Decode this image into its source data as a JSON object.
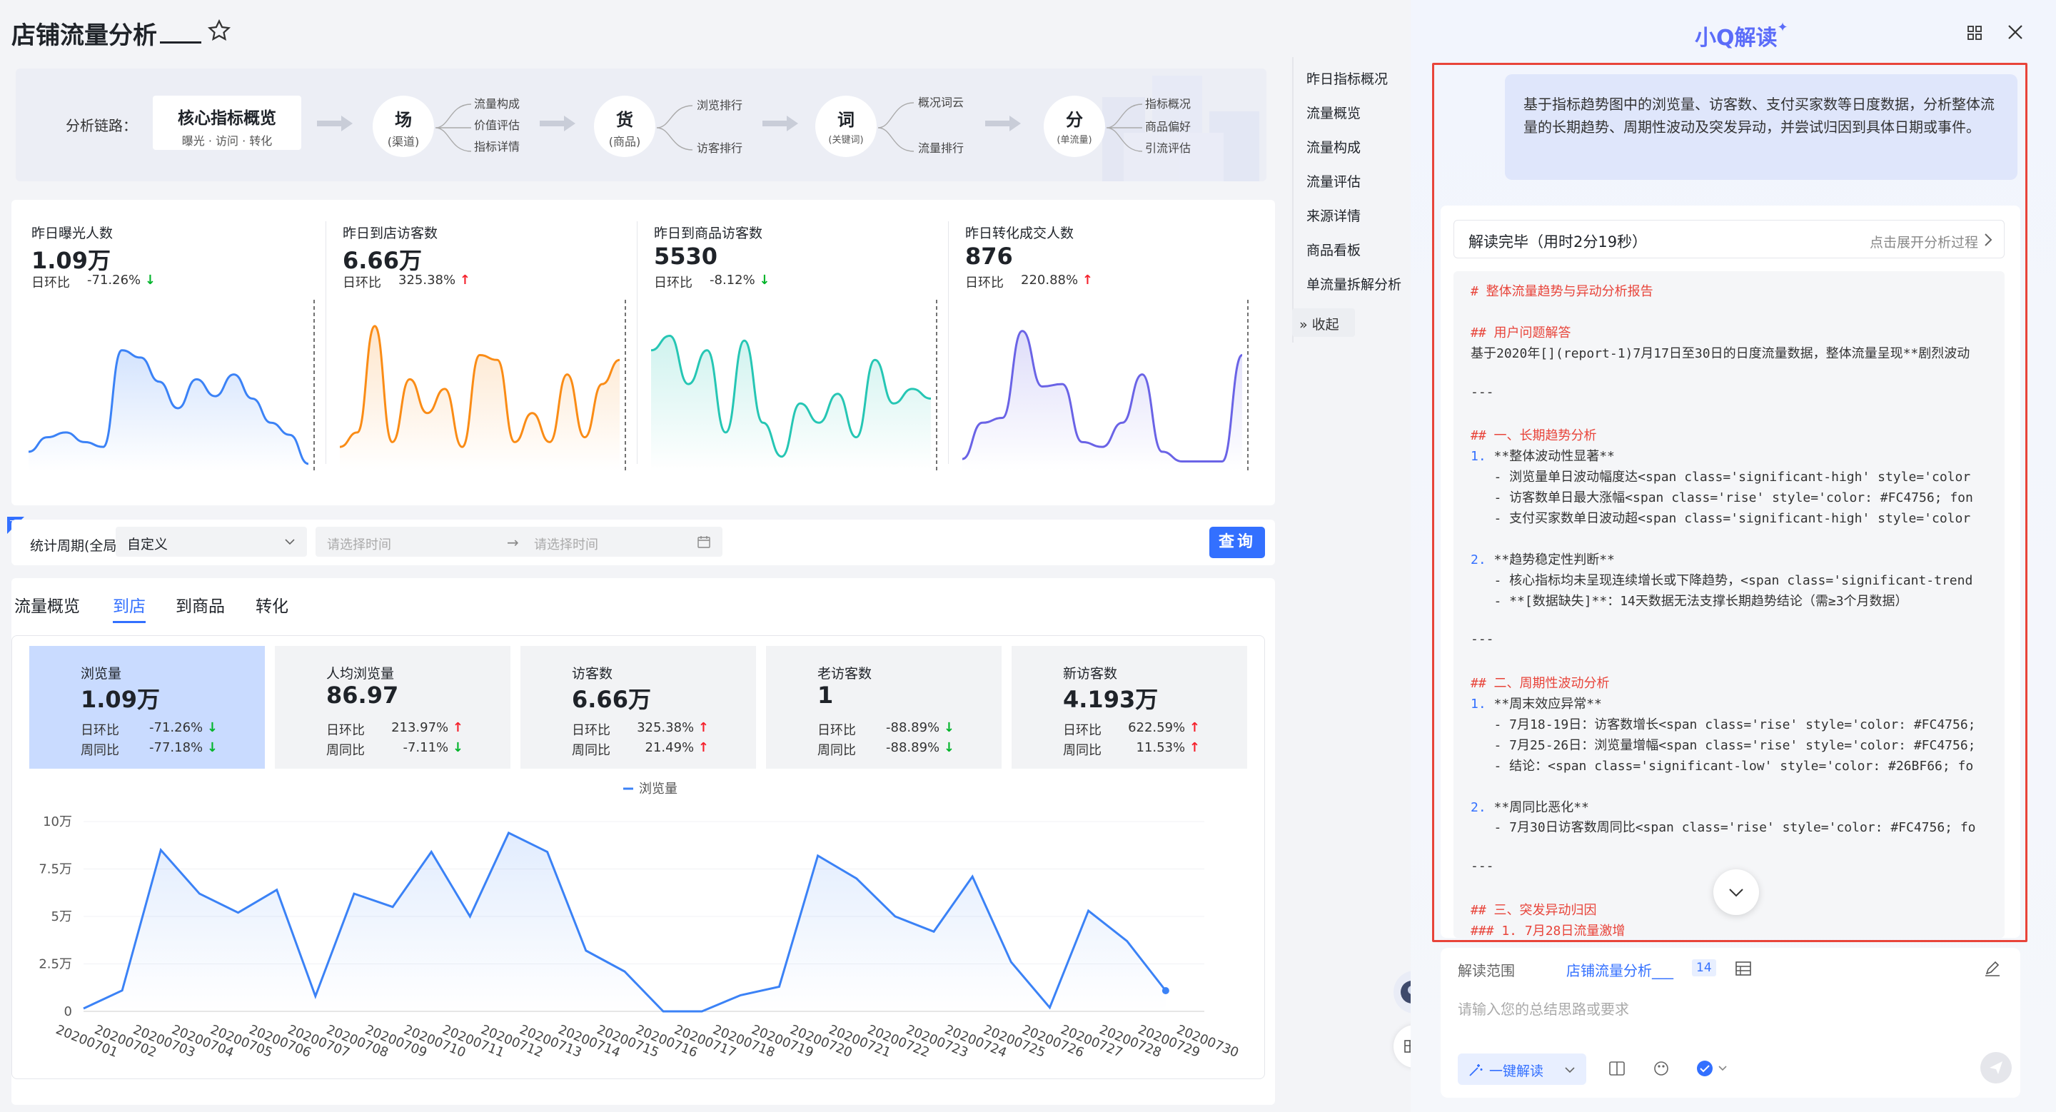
{
  "header": {
    "title": "店铺流量分析"
  },
  "chain": {
    "label": "分析链路：",
    "core_title": "核心指标概览",
    "core_sub": "曝光 · 访问 · 转化",
    "nodes": [
      {
        "t": "场",
        "s": "(渠道)",
        "subs": [
          "流量构成",
          "价值评估",
          "指标详情"
        ]
      },
      {
        "t": "货",
        "s": "(商品)",
        "subs": [
          "浏览排行",
          "访客排行"
        ]
      },
      {
        "t": "词",
        "s": "(关键词)",
        "subs": [
          "概况词云",
          "流量排行"
        ]
      },
      {
        "t": "分",
        "s": "(单流量)",
        "subs": [
          "指标概况",
          "商品偏好",
          "引流评估"
        ]
      }
    ]
  },
  "kpis": [
    {
      "label": "昨日曝光人数",
      "value": "1.09万",
      "ratio_label": "日环比",
      "ratio": "-71.26%",
      "dir": "down",
      "color": "#3b82f6",
      "series": [
        8,
        14,
        16,
        12,
        10,
        50,
        47,
        37,
        26,
        38,
        31,
        40,
        30,
        20,
        15,
        3
      ]
    },
    {
      "label": "昨日到店访客数",
      "value": "6.66万",
      "ratio_label": "日环比",
      "ratio": "325.38%",
      "dir": "up",
      "color": "#fa8c16",
      "series": [
        10,
        16,
        60,
        12,
        38,
        24,
        34,
        10,
        48,
        46,
        12,
        24,
        12,
        40,
        14,
        36,
        46
      ]
    },
    {
      "label": "昨日到商品访客数",
      "value": "5530",
      "ratio_label": "日环比",
      "ratio": "-8.12%",
      "dir": "down",
      "color": "#26c6b4",
      "series": [
        50,
        56,
        36,
        50,
        16,
        54,
        20,
        6,
        28,
        20,
        32,
        14,
        46,
        28,
        34,
        30
      ]
    },
    {
      "label": "昨日转化成交人数",
      "value": "876",
      "ratio_label": "日环比",
      "ratio": "220.88%",
      "dir": "up",
      "color": "#6a63e6",
      "series": [
        5,
        20,
        22,
        58,
        35,
        36,
        12,
        10,
        20,
        40,
        8,
        4,
        4,
        4,
        48
      ]
    }
  ],
  "filter": {
    "label": "统计周期(全局)",
    "select": "自定义",
    "start_placeholder": "请选择时间",
    "end_placeholder": "请选择时间",
    "query": "查询"
  },
  "tabs": [
    "流量概览",
    "到店",
    "到商品",
    "转化"
  ],
  "metrics": [
    {
      "label": "浏览量",
      "value": "1.09万",
      "d_label": "日环比",
      "d": "-71.26%",
      "d_dir": "down",
      "w_label": "周同比",
      "w": "-77.18%",
      "w_dir": "down",
      "selected": true
    },
    {
      "label": "人均浏览量",
      "value": "86.97",
      "d_label": "日环比",
      "d": "213.97%",
      "d_dir": "up",
      "w_label": "周同比",
      "w": "-7.11%",
      "w_dir": "down"
    },
    {
      "label": "访客数",
      "value": "6.66万",
      "d_label": "日环比",
      "d": "325.38%",
      "d_dir": "up",
      "w_label": "周同比",
      "w": "21.49%",
      "w_dir": "up"
    },
    {
      "label": "老访客数",
      "value": "1",
      "d_label": "日环比",
      "d": "-88.89%",
      "d_dir": "down",
      "w_label": "周同比",
      "w": "-88.89%",
      "w_dir": "down"
    },
    {
      "label": "新访客数",
      "value": "4.193万",
      "d_label": "日环比",
      "d": "622.59%",
      "d_dir": "up",
      "w_label": "周同比",
      "w": "11.53%",
      "w_dir": "up"
    }
  ],
  "chart_data": {
    "type": "area",
    "legend": "浏览量",
    "legend_position": "top-center",
    "y_ticks": [
      "0",
      "2.5万",
      "5万",
      "7.5万",
      "10万"
    ],
    "ylim": [
      0,
      100000
    ],
    "x": [
      "20200701",
      "20200702",
      "20200703",
      "20200704",
      "20200705",
      "20200706",
      "20200707",
      "20200708",
      "20200709",
      "20200710",
      "20200711",
      "20200712",
      "20200713",
      "20200714",
      "20200715",
      "20200716",
      "20200717",
      "20200718",
      "20200719",
      "20200720",
      "20200721",
      "20200722",
      "20200723",
      "20200724",
      "20200725",
      "20200726",
      "20200727",
      "20200728",
      "20200729",
      "20200730"
    ],
    "series": [
      {
        "name": "浏览量",
        "values": [
          1500,
          11000,
          85000,
          62000,
          52000,
          64000,
          8000,
          62000,
          55000,
          84000,
          50000,
          94000,
          84000,
          32000,
          21000,
          0,
          0,
          8500,
          13000,
          82000,
          70000,
          50000,
          42000,
          71000,
          26000,
          2000,
          53000,
          37000,
          10900,
          10900
        ]
      }
    ],
    "grid": true
  },
  "right_nav": [
    "昨日指标概况",
    "流量概览",
    "流量构成",
    "流量评估",
    "来源详情",
    "商品看板",
    "单流量拆解分析"
  ],
  "collapse": "收起",
  "panel": {
    "title": "小Q解读",
    "user_msg": "基于指标趋势图中的浏览量、访客数、支付买家数等日度数据，分析整体流量的长期趋势、周期性波动及突发异动，并尝试归因到具体日期或事件。",
    "status": "解读完毕（用时2分19秒）",
    "expand": "点击展开分析过程",
    "lines": [
      {
        "c": "h",
        "t": "# 整体流量趋势与异动分析报告"
      },
      {
        "c": "",
        "t": ""
      },
      {
        "c": "h",
        "t": "## 用户问题解答"
      },
      {
        "c": "",
        "t": "基于2020年[](report-1)7月17日至30日的日度流量数据，整体流量呈现**剧烈波动"
      },
      {
        "c": "",
        "t": ""
      },
      {
        "c": "",
        "t": "---"
      },
      {
        "c": "",
        "t": ""
      },
      {
        "c": "h",
        "t": "## 一、长期趋势分析"
      },
      {
        "c": "num",
        "t": "1. **整体波动性显著**"
      },
      {
        "c": "",
        "t": "   - 浏览量单日波动幅度达<span class='significant-high' style='color"
      },
      {
        "c": "",
        "t": "   - 访客数单日最大涨幅<span class='rise' style='color: #FC4756; fon"
      },
      {
        "c": "",
        "t": "   - 支付买家数单日波动超<span class='significant-high' style='color"
      },
      {
        "c": "",
        "t": ""
      },
      {
        "c": "num",
        "t": "2. **趋势稳定性判断**"
      },
      {
        "c": "",
        "t": "   - 核心指标均未呈现连续增长或下降趋势，<span class='significant-trend"
      },
      {
        "c": "",
        "t": "   - **[数据缺失]**：14天数据无法支撑长期趋势结论（需≥3个月数据）"
      },
      {
        "c": "",
        "t": ""
      },
      {
        "c": "",
        "t": "---"
      },
      {
        "c": "",
        "t": ""
      },
      {
        "c": "h",
        "t": "## 二、周期性波动分析"
      },
      {
        "c": "num",
        "t": "1. **周末效应异常**"
      },
      {
        "c": "",
        "t": "   - 7月18-19日：访客数增长<span class='rise' style='color: #FC4756;"
      },
      {
        "c": "",
        "t": "   - 7月25-26日：浏览量增幅<span class='rise' style='color: #FC4756;"
      },
      {
        "c": "",
        "t": "   - 结论：<span class='significant-low' style='color: #26BF66; fo"
      },
      {
        "c": "",
        "t": ""
      },
      {
        "c": "num",
        "t": "2. **周同比恶化**"
      },
      {
        "c": "",
        "t": "   - 7月30日访客数周同比<span class='rise' style='color: #FC4756; fo"
      },
      {
        "c": "",
        "t": ""
      },
      {
        "c": "",
        "t": "---"
      },
      {
        "c": "",
        "t": ""
      },
      {
        "c": "h",
        "t": "## 三、突发异动归因"
      },
      {
        "c": "h",
        "t": "### 1. 7月28日流量激增"
      }
    ],
    "scope_label": "解读范围",
    "scope_link": "店铺流量分析___",
    "scope_count": "14",
    "input_placeholder": "请输入您的总结思路或要求",
    "one_click": "一键解读"
  }
}
